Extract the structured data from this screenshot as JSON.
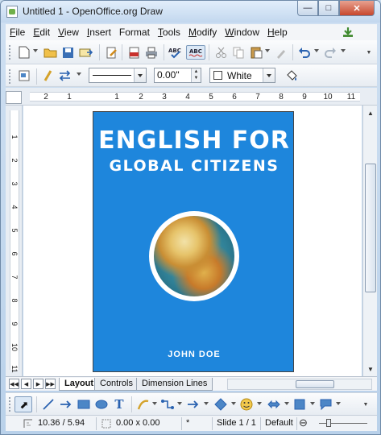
{
  "window": {
    "title": "Untitled 1 - OpenOffice.org Draw"
  },
  "menu": [
    {
      "label": "File",
      "key": "F",
      "rest": "ile"
    },
    {
      "label": "Edit",
      "key": "E",
      "rest": "dit"
    },
    {
      "label": "View",
      "key": "V",
      "rest": "iew"
    },
    {
      "label": "Insert",
      "key": "I",
      "rest": "nsert"
    },
    {
      "label": "Format",
      "key": "",
      "rest": "Format"
    },
    {
      "label": "Tools",
      "key": "T",
      "rest": "ools"
    },
    {
      "label": "Modify",
      "key": "M",
      "rest": "odify"
    },
    {
      "label": "Window",
      "key": "W",
      "rest": "indow"
    },
    {
      "label": "Help",
      "key": "H",
      "rest": "elp"
    }
  ],
  "line_toolbar": {
    "line_width_value": "0.00\"",
    "area_color_label": "White"
  },
  "ruler": {
    "horizontal_ticks": [
      "2",
      "1",
      "1",
      "2",
      "3",
      "4",
      "5",
      "6",
      "7",
      "8",
      "9",
      "10",
      "11"
    ],
    "vertical_ticks": [
      "1",
      "2",
      "3",
      "4",
      "5",
      "6",
      "7",
      "8",
      "9",
      "10",
      "11"
    ]
  },
  "document": {
    "title_line1": "ENGLISH FOR",
    "title_line2": "GLOBAL CITIZENS",
    "author": "JOHN DOE",
    "cover_color": "#1e86dc"
  },
  "tabs": [
    {
      "label": "Layout",
      "active": true
    },
    {
      "label": "Controls",
      "active": false
    },
    {
      "label": "Dimension Lines",
      "active": false
    }
  ],
  "status": {
    "position": "10.36 / 5.94",
    "size": "0.00 x 0.00",
    "modified": "*",
    "slide": "Slide 1 / 1",
    "layout": "Default",
    "zoom_out_symbol": "⊖"
  }
}
